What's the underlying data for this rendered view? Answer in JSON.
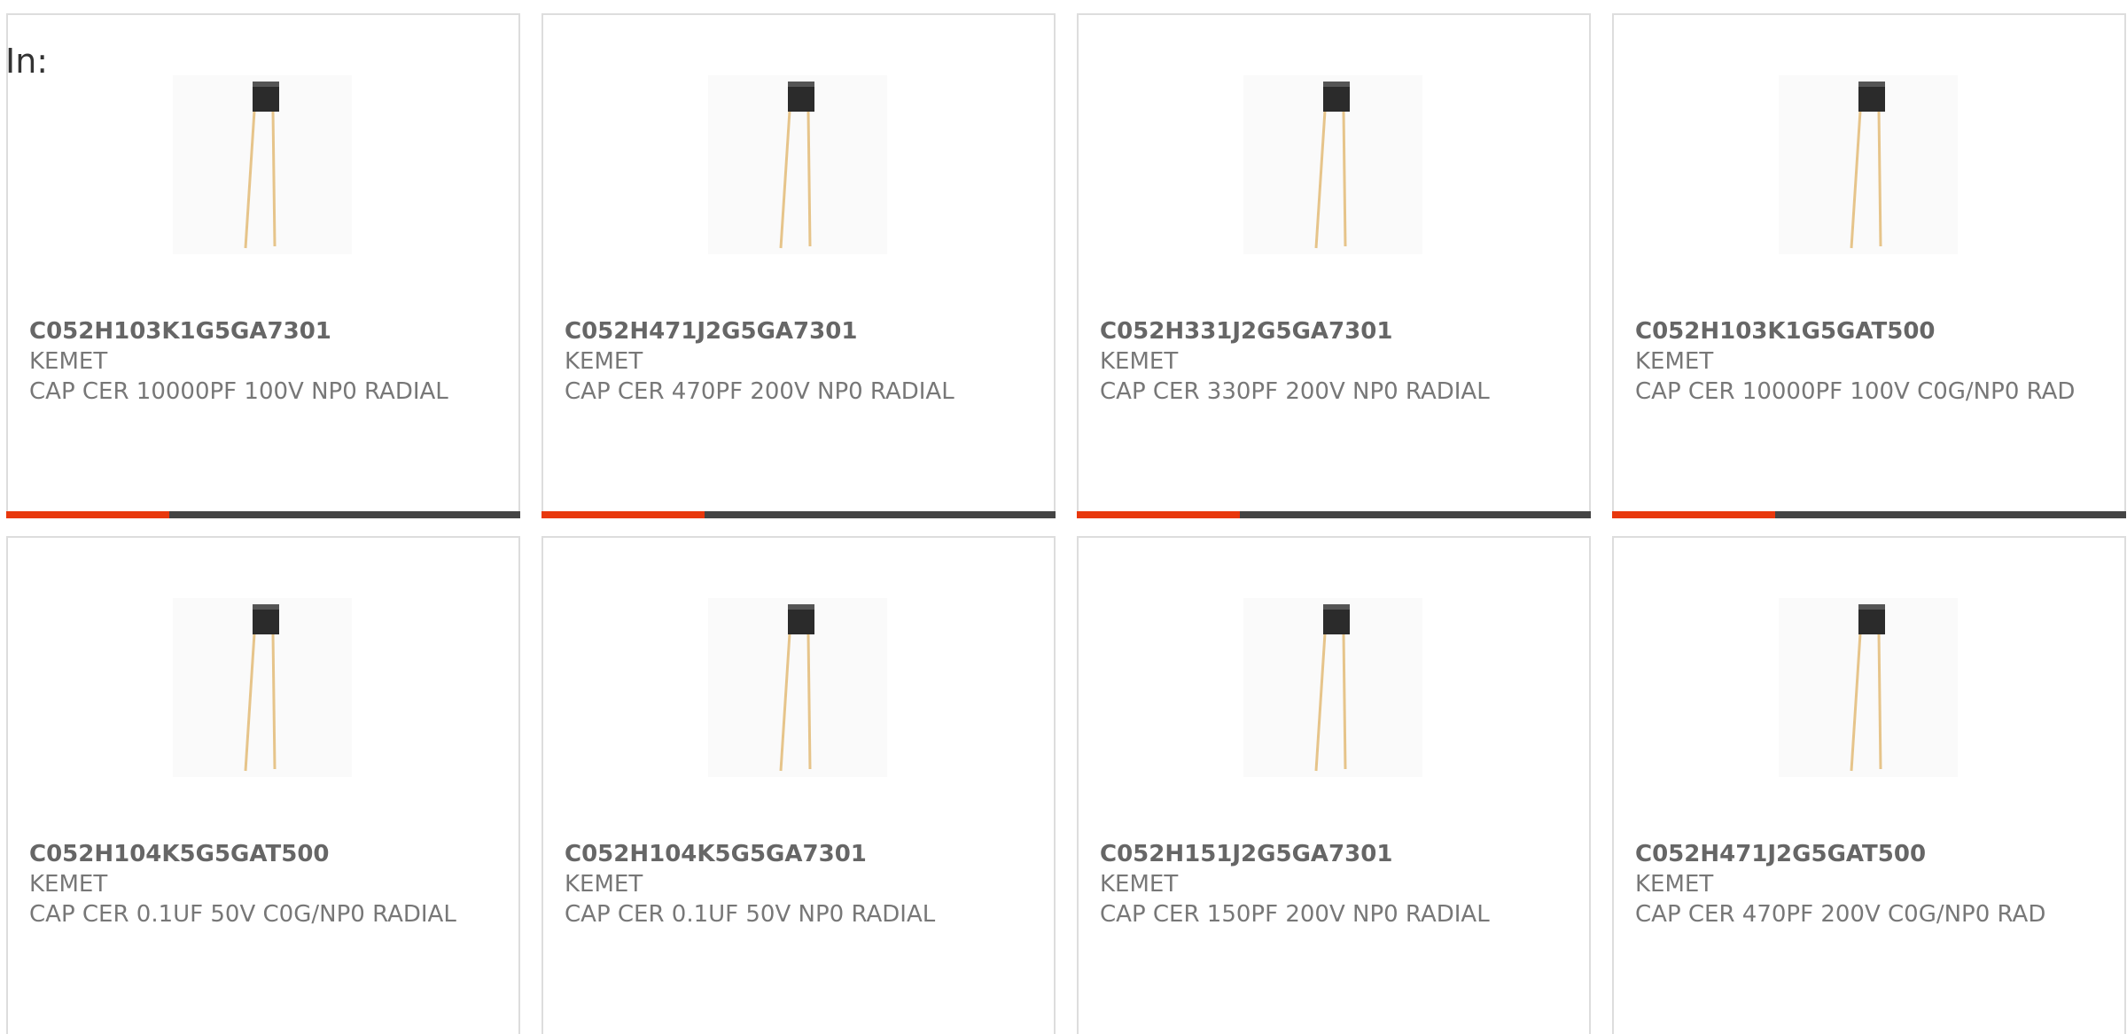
{
  "header": {
    "label": "In:"
  },
  "accent_color": "#e8380d",
  "bar_color": "#444444",
  "products": [
    {
      "part_number": "C052H103K1G5GA7301",
      "manufacturer": "KEMET",
      "description": "CAP CER 10000PF 100V NP0 RADIAL",
      "image_icon": "radial-capacitor-icon"
    },
    {
      "part_number": "C052H471J2G5GA7301",
      "manufacturer": "KEMET",
      "description": "CAP CER 470PF 200V NP0 RADIAL",
      "image_icon": "radial-capacitor-icon"
    },
    {
      "part_number": "C052H331J2G5GA7301",
      "manufacturer": "KEMET",
      "description": "CAP CER 330PF 200V NP0 RADIAL",
      "image_icon": "radial-capacitor-icon"
    },
    {
      "part_number": "C052H103K1G5GAT500",
      "manufacturer": "KEMET",
      "description": "CAP CER 10000PF 100V C0G/NP0 RAD",
      "image_icon": "radial-capacitor-icon"
    },
    {
      "part_number": "C052H104K5G5GAT500",
      "manufacturer": "KEMET",
      "description": "CAP CER 0.1UF 50V C0G/NP0 RADIAL",
      "image_icon": "radial-capacitor-icon"
    },
    {
      "part_number": "C052H104K5G5GA7301",
      "manufacturer": "KEMET",
      "description": "CAP CER 0.1UF 50V NP0 RADIAL",
      "image_icon": "radial-capacitor-icon"
    },
    {
      "part_number": "C052H151J2G5GA7301",
      "manufacturer": "KEMET",
      "description": "CAP CER 150PF 200V NP0 RADIAL",
      "image_icon": "radial-capacitor-icon"
    },
    {
      "part_number": "C052H471J2G5GAT500",
      "manufacturer": "KEMET",
      "description": "CAP CER 470PF 200V C0G/NP0 RAD",
      "image_icon": "radial-capacitor-icon"
    }
  ]
}
